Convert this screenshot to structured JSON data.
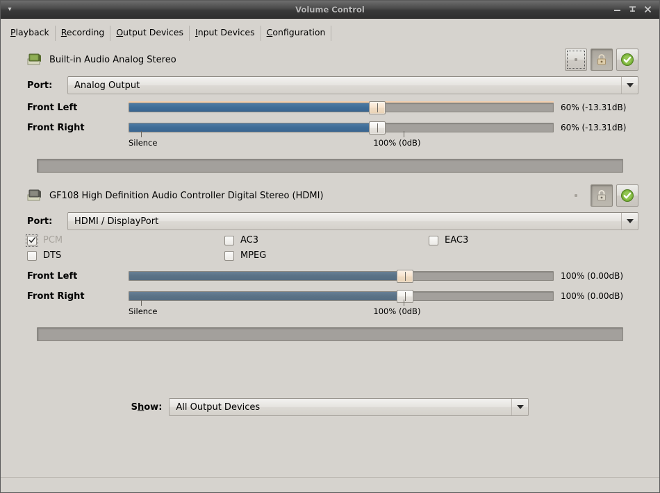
{
  "window": {
    "title": "Volume Control",
    "menu_icon": "chevron-down-icon",
    "minimize_label": "Minimize",
    "maximize_label": "Maximize",
    "close_label": "Close"
  },
  "tabs": [
    {
      "label": "Playback",
      "mnemonic": "P"
    },
    {
      "label": "Recording",
      "mnemonic": "R"
    },
    {
      "label": "Output Devices",
      "mnemonic": "O"
    },
    {
      "label": "Input Devices",
      "mnemonic": "I"
    },
    {
      "label": "Configuration",
      "mnemonic": "C"
    }
  ],
  "devices": [
    {
      "name": "Built-in Audio Analog Stereo",
      "icon": "audio-card-icon",
      "actions": {
        "mute_icon": "speaker-mute-icon",
        "lock_icon": "lock-icon",
        "default_icon": "green-check-icon"
      },
      "port_label": "Port:",
      "port_value": "Analog Output",
      "encodings": [],
      "channels": [
        {
          "label": "Front Left",
          "value": "60% (-13.31dB)",
          "percent": 60,
          "hover": true
        },
        {
          "label": "Front Right",
          "value": "60% (-13.31dB)",
          "percent": 60,
          "hover": false
        }
      ],
      "scale": {
        "min_label": "Silence",
        "max_label": "100% (0dB)"
      }
    },
    {
      "name": "GF108 High Definition Audio Controller Digital Stereo (HDMI)",
      "icon": "audio-card-icon",
      "actions": {
        "mute_icon": "speaker-mute-icon",
        "lock_icon": "lock-icon",
        "default_icon": "green-check-icon"
      },
      "port_label": "Port:",
      "port_value": "HDMI / DisplayPort",
      "encodings": [
        {
          "label": "PCM",
          "checked": true,
          "disabled": true
        },
        {
          "label": "AC3",
          "checked": false,
          "disabled": false
        },
        {
          "label": "EAC3",
          "checked": false,
          "disabled": false
        },
        {
          "label": "DTS",
          "checked": false,
          "disabled": false
        },
        {
          "label": "MPEG",
          "checked": false,
          "disabled": false
        }
      ],
      "channels": [
        {
          "label": "Front Left",
          "value": "100% (0.00dB)",
          "percent": 100,
          "hover": true
        },
        {
          "label": "Front Right",
          "value": "100% (0.00dB)",
          "percent": 100,
          "hover": false
        }
      ],
      "scale": {
        "min_label": "Silence",
        "max_label": "100% (0dB)"
      }
    }
  ],
  "footer": {
    "show_label": "Show:",
    "show_value": "All Output Devices"
  },
  "colors": {
    "slider_fill": "#3f6d97",
    "slider_fill_dim": "#5a7286",
    "accent_green": "#5aa02c",
    "hover_warm": "#f2cfae",
    "window_bg": "#d6d3ce"
  }
}
